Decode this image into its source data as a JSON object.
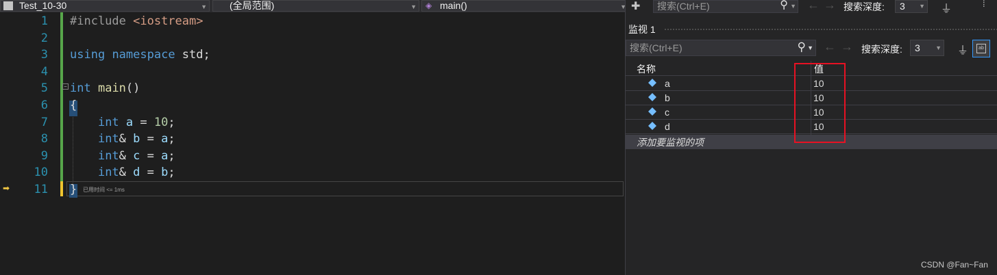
{
  "nav": {
    "project": "Test_10-30",
    "scope": "(全局范围)",
    "function": "main()"
  },
  "top_search": {
    "placeholder": "搜索(Ctrl+E)",
    "depth_label": "搜索深度:",
    "depth_value": "3"
  },
  "editor": {
    "line_numbers": [
      "1",
      "2",
      "3",
      "4",
      "5",
      "6",
      "7",
      "8",
      "9",
      "10",
      "11"
    ],
    "lines": [
      [
        {
          "t": "#include ",
          "c": "pp"
        },
        {
          "t": "<iostream>",
          "c": "str"
        }
      ],
      [],
      [
        {
          "t": "using",
          "c": "kw"
        },
        {
          "t": " ",
          "c": ""
        },
        {
          "t": "namespace",
          "c": "kw"
        },
        {
          "t": " std;",
          "c": ""
        }
      ],
      [],
      [
        {
          "t": "int",
          "c": "kw"
        },
        {
          "t": " ",
          "c": ""
        },
        {
          "t": "main",
          "c": "fn"
        },
        {
          "t": "()",
          "c": ""
        }
      ],
      [
        {
          "t": "{",
          "c": ""
        }
      ],
      [
        {
          "t": "    ",
          "c": ""
        },
        {
          "t": "int",
          "c": "kw"
        },
        {
          "t": " ",
          "c": ""
        },
        {
          "t": "a",
          "c": "var"
        },
        {
          "t": " = ",
          "c": ""
        },
        {
          "t": "10",
          "c": "num"
        },
        {
          "t": ";",
          "c": ""
        }
      ],
      [
        {
          "t": "    ",
          "c": ""
        },
        {
          "t": "int",
          "c": "kw"
        },
        {
          "t": "& ",
          "c": ""
        },
        {
          "t": "b",
          "c": "var"
        },
        {
          "t": " = ",
          "c": ""
        },
        {
          "t": "a",
          "c": "var"
        },
        {
          "t": ";",
          "c": ""
        }
      ],
      [
        {
          "t": "    ",
          "c": ""
        },
        {
          "t": "int",
          "c": "kw"
        },
        {
          "t": "& ",
          "c": ""
        },
        {
          "t": "c",
          "c": "var"
        },
        {
          "t": " = ",
          "c": ""
        },
        {
          "t": "a",
          "c": "var"
        },
        {
          "t": ";",
          "c": ""
        }
      ],
      [
        {
          "t": "    ",
          "c": ""
        },
        {
          "t": "int",
          "c": "kw"
        },
        {
          "t": "& ",
          "c": ""
        },
        {
          "t": "d",
          "c": "var"
        },
        {
          "t": " = ",
          "c": ""
        },
        {
          "t": "b",
          "c": "var"
        },
        {
          "t": ";",
          "c": ""
        }
      ],
      [
        {
          "t": "}",
          "c": ""
        }
      ]
    ],
    "perf_tip": "已用时间 <= 1ms"
  },
  "watch": {
    "title": "监视 1",
    "search_placeholder": "搜索(Ctrl+E)",
    "depth_label": "搜索深度:",
    "depth_value": "3",
    "col_name": "名称",
    "col_value": "值",
    "rows": [
      {
        "name": "a",
        "value": "10"
      },
      {
        "name": "b",
        "value": "10"
      },
      {
        "name": "c",
        "value": "10"
      },
      {
        "name": "d",
        "value": "10"
      }
    ],
    "add_item": "添加要监视的项"
  },
  "watermark": "CSDN @Fan~Fan",
  "colors": {
    "highlight_box": "#e81123",
    "keyword": "#569cd6",
    "line_number": "#2b91af"
  }
}
